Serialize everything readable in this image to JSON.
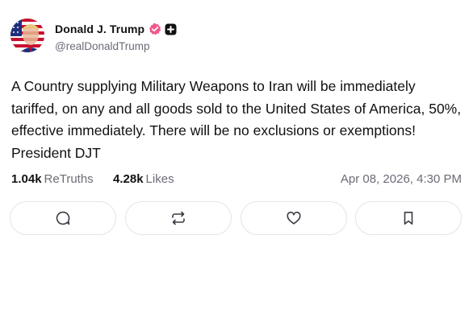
{
  "header": {
    "display_name": "Donald J. Trump",
    "handle": "@realDonaldTrump",
    "avatar_icon": "flag-portrait-avatar",
    "verified_icon": "verified-badge-icon",
    "plus_icon": "plus-badge-icon"
  },
  "post": {
    "text": "A Country supplying Military Weapons to Iran will be immediately tariffed, on any and all goods sold to the United States of America, 50%, effective immediately. There will be no exclusions or exemptions! President DJT"
  },
  "stats": {
    "retruths_count": "1.04k",
    "retruths_label": "ReTruths",
    "likes_count": "4.28k",
    "likes_label": "Likes",
    "timestamp": "Apr 08, 2026, 4:30 PM"
  },
  "actions": [
    {
      "icon": "reply-icon"
    },
    {
      "icon": "retruth-icon"
    },
    {
      "icon": "like-icon"
    },
    {
      "icon": "bookmark-icon"
    }
  ],
  "colors": {
    "verified_badge": "#f0598a",
    "muted_text": "#6b6b78",
    "border": "#e4e4ea"
  }
}
